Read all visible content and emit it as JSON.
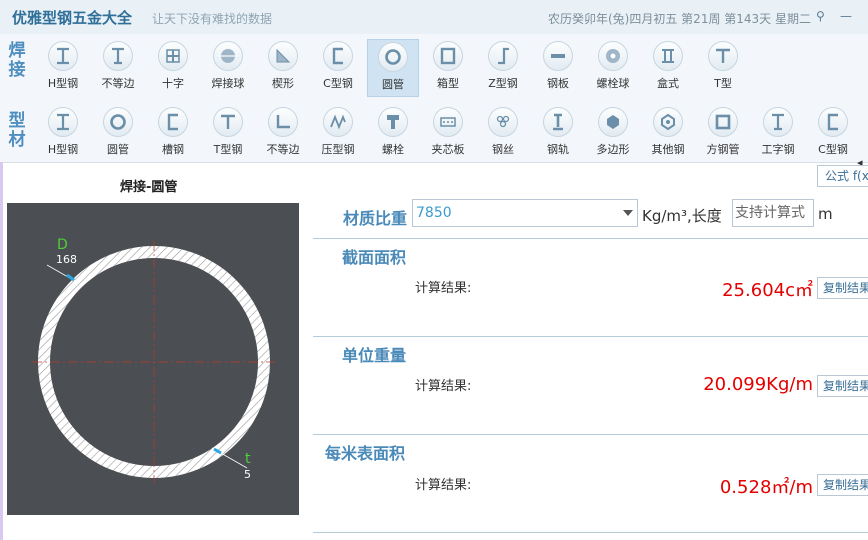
{
  "app": {
    "title": "优雅型钢五金大全",
    "slogan": "让天下没有难找的数据",
    "date_info": "农历癸卯年(兔)四月初五 第21周 第143天 星期二",
    "pin_glyph": "⚲",
    "minimize_glyph": "—"
  },
  "toolbar": {
    "row1_label": "焊接",
    "row2_label": "型材",
    "row1_items": [
      {
        "label": "H型钢",
        "icon": "h-beam"
      },
      {
        "label": "不等边",
        "icon": "i-beam"
      },
      {
        "label": "十字",
        "icon": "cross"
      },
      {
        "label": "焊接球",
        "icon": "sphere"
      },
      {
        "label": "楔形",
        "icon": "wedge"
      },
      {
        "label": "C型钢",
        "icon": "c-channel"
      },
      {
        "label": "圆管",
        "icon": "round-tube"
      },
      {
        "label": "箱型",
        "icon": "box"
      },
      {
        "label": "Z型钢",
        "icon": "z-section"
      },
      {
        "label": "钢板",
        "icon": "plate"
      },
      {
        "label": "螺栓球",
        "icon": "bolt-ball"
      },
      {
        "label": "盒式",
        "icon": "box-double"
      },
      {
        "label": "T型",
        "icon": "t-section"
      }
    ],
    "row2_items": [
      {
        "label": "H型钢",
        "icon": "h-beam"
      },
      {
        "label": "圆管",
        "icon": "round-tube"
      },
      {
        "label": "槽钢",
        "icon": "c-channel"
      },
      {
        "label": "T型钢",
        "icon": "t-section"
      },
      {
        "label": "不等边",
        "icon": "angle"
      },
      {
        "label": "压型钢",
        "icon": "corrugated"
      },
      {
        "label": "螺栓",
        "icon": "bolt"
      },
      {
        "label": "夹芯板",
        "icon": "sandwich"
      },
      {
        "label": "钢丝",
        "icon": "wire"
      },
      {
        "label": "钢轨",
        "icon": "rail"
      },
      {
        "label": "多边形",
        "icon": "polygon"
      },
      {
        "label": "其他钢",
        "icon": "other"
      },
      {
        "label": "方钢管",
        "icon": "square-tube"
      },
      {
        "label": "工字钢",
        "icon": "i-beam"
      },
      {
        "label": "C型钢",
        "icon": "c-channel"
      }
    ],
    "selected_index_row1": 6,
    "scroll_glyph": "◂"
  },
  "drawing": {
    "title": "焊接-圆管",
    "diameter_symbol": "D",
    "diameter_value": "168",
    "thickness_symbol": "t",
    "thickness_value": "5",
    "canvas_bg": "#4b4e52",
    "symbol_color": "#4cd137"
  },
  "form": {
    "formula_button": "公式 f(x)",
    "density_label": "材质比重",
    "density_value": "7850",
    "density_unit": "Kg/m³,长度",
    "length_placeholder": "支持计算式",
    "length_unit": "m"
  },
  "results": [
    {
      "title": "截面面积",
      "label": "计算结果:",
      "value": "25.604c㎡",
      "copy": "复制结果"
    },
    {
      "title": "单位重量",
      "label": "计算结果:",
      "value": "20.099Kg/m",
      "copy": "复制结果"
    },
    {
      "title": "每米表面积",
      "label": "计算结果:",
      "value": "0.528㎡/m",
      "copy": "复制结果"
    }
  ],
  "colors": {
    "accent": "#4a8ab8",
    "result_red": "#e50000",
    "selected_tool": "#cfe3f3"
  }
}
